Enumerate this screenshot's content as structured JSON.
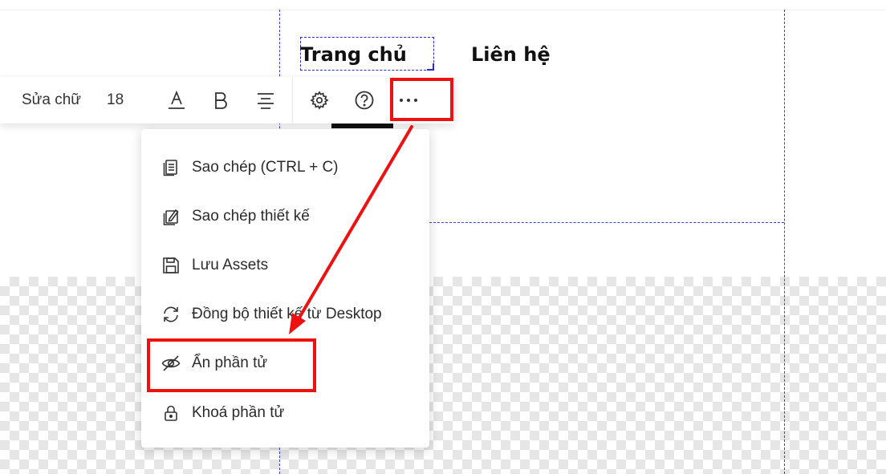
{
  "canvas": {
    "nav_items": [
      "Trang chủ",
      "Liên hệ"
    ]
  },
  "toolbar": {
    "edit_text_label": "Sửa chữ",
    "font_size": "18",
    "icons": [
      "text-color-icon",
      "bold-icon",
      "align-icon",
      "settings-icon",
      "help-icon",
      "more-icon"
    ]
  },
  "menu": {
    "items": [
      {
        "label": "Sao chép (CTRL + C)",
        "icon": "copy-icon"
      },
      {
        "label": "Sao chép thiết kế",
        "icon": "copy-design-icon"
      },
      {
        "label": "Lưu Assets",
        "icon": "save-icon"
      },
      {
        "label": "Đồng bộ thiết kế từ Desktop",
        "icon": "sync-icon"
      },
      {
        "label": "Ẩn phần tử",
        "icon": "eye-off-icon"
      },
      {
        "label": "Khoá phần tử",
        "icon": "lock-icon"
      }
    ]
  },
  "colors": {
    "highlight": "#ee1111",
    "guide": "#3f3fd6"
  }
}
